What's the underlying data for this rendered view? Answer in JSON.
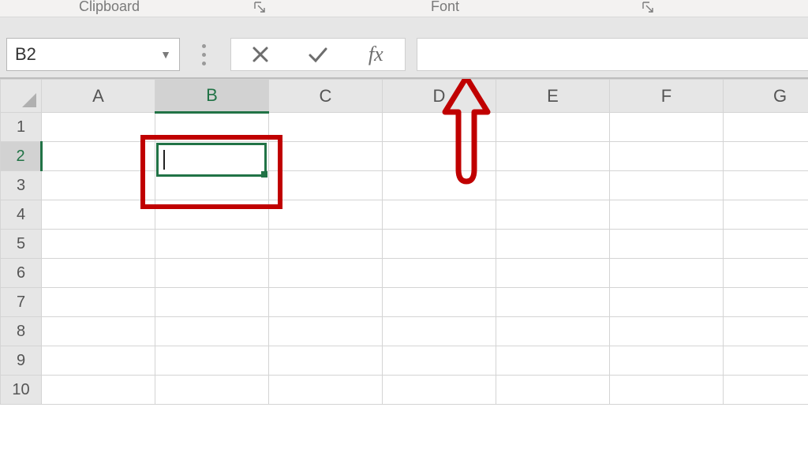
{
  "ribbon": {
    "group_clipboard": "Clipboard",
    "group_font": "Font"
  },
  "name_box": {
    "value": "B2"
  },
  "fx": {
    "label": "fx"
  },
  "formula_bar": {
    "value": ""
  },
  "columns": [
    "A",
    "B",
    "C",
    "D",
    "E",
    "F",
    "G"
  ],
  "rows": [
    "1",
    "2",
    "3",
    "4",
    "5",
    "6",
    "7",
    "8",
    "9",
    "10"
  ],
  "active": {
    "col": "B",
    "row": "2",
    "col_index": 1,
    "row_index": 1
  },
  "cells": {}
}
